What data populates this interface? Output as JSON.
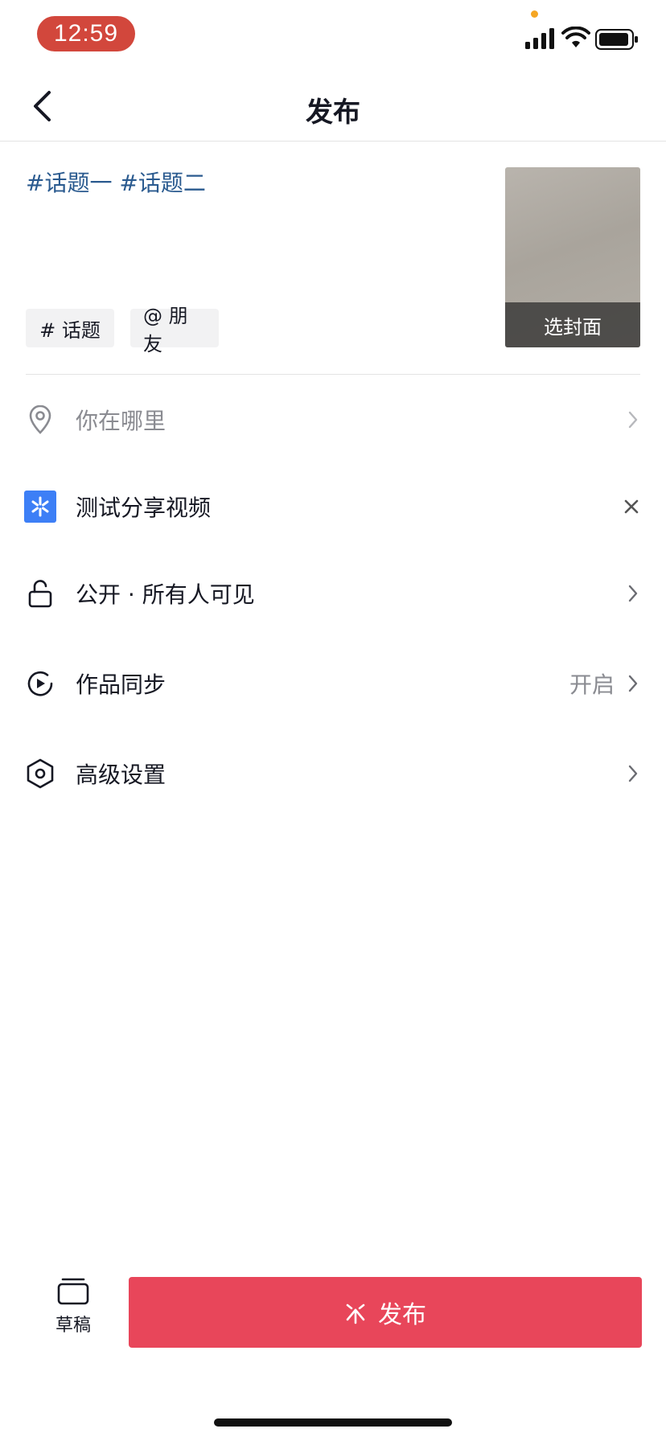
{
  "status_bar": {
    "time": "12:59"
  },
  "nav": {
    "title": "发布"
  },
  "caption": {
    "text": "#话题一 #话题二"
  },
  "chips": {
    "topic": "# 话题",
    "friend": "@ 朋友"
  },
  "cover": {
    "label": "选封面"
  },
  "rows": {
    "location": {
      "label": "你在哪里",
      "icon": "location-pin-icon"
    },
    "share": {
      "label": "测试分享视频",
      "icon": "share-app-icon",
      "icon_color": "#3d7ff6"
    },
    "visibility": {
      "label": "公开 · 所有人可见",
      "icon": "unlock-icon"
    },
    "sync": {
      "label": "作品同步",
      "value": "开启",
      "icon": "sync-icon"
    },
    "advanced": {
      "label": "高级设置",
      "icon": "hexagon-settings-icon"
    }
  },
  "bottom": {
    "draft_label": "草稿",
    "publish_label": "发布",
    "publish_color": "#e8465a"
  }
}
